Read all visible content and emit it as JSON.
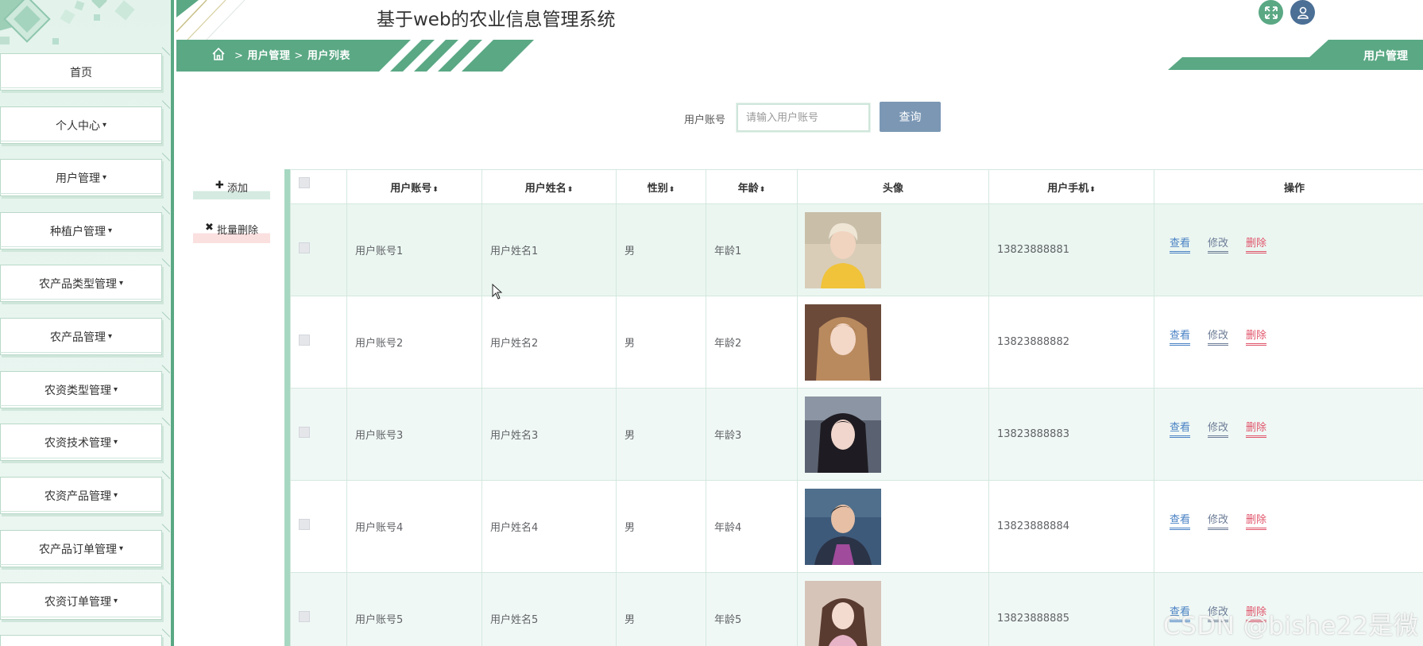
{
  "app": {
    "title": "基于web的农业信息管理系统"
  },
  "sidebar": {
    "items": [
      {
        "label": "首页",
        "has_caret": false
      },
      {
        "label": "个人中心",
        "has_caret": true
      },
      {
        "label": "用户管理",
        "has_caret": true
      },
      {
        "label": "种植户管理",
        "has_caret": true
      },
      {
        "label": "农产品类型管理",
        "has_caret": true
      },
      {
        "label": "农产品管理",
        "has_caret": true
      },
      {
        "label": "农资类型管理",
        "has_caret": true
      },
      {
        "label": "农资技术管理",
        "has_caret": true
      },
      {
        "label": "农资产品管理",
        "has_caret": true
      },
      {
        "label": "农产品订单管理",
        "has_caret": true
      },
      {
        "label": "农资订单管理",
        "has_caret": true
      }
    ],
    "caret": "▾"
  },
  "header": {
    "fullscreen_icon": "fullscreen-icon",
    "user_icon": "user-icon"
  },
  "breadcrumb": {
    "home_icon": "home-icon",
    "separator": ">",
    "items": [
      "用户管理",
      "用户列表"
    ]
  },
  "right_tab": {
    "label": "用户管理"
  },
  "search": {
    "label": "用户账号",
    "placeholder": "请输入用户账号",
    "button_label": "查询"
  },
  "actions": {
    "add_icon": "✚",
    "add_label": "添加",
    "batch_delete_icon": "✖",
    "batch_delete_label": "批量删除"
  },
  "table": {
    "columns": [
      {
        "label": "用户账号",
        "sortable": true
      },
      {
        "label": "用户姓名",
        "sortable": true
      },
      {
        "label": "性别",
        "sortable": true
      },
      {
        "label": "年龄",
        "sortable": true
      },
      {
        "label": "头像",
        "sortable": false
      },
      {
        "label": "用户手机",
        "sortable": true
      },
      {
        "label": "操作",
        "sortable": false
      }
    ],
    "sort_icon": "⬍",
    "rows": [
      {
        "account": "用户账号1",
        "name": "用户姓名1",
        "gender": "男",
        "age": "年龄1",
        "phone": "13823888881"
      },
      {
        "account": "用户账号2",
        "name": "用户姓名2",
        "gender": "男",
        "age": "年龄2",
        "phone": "13823888882"
      },
      {
        "account": "用户账号3",
        "name": "用户姓名3",
        "gender": "男",
        "age": "年龄3",
        "phone": "13823888883"
      },
      {
        "account": "用户账号4",
        "name": "用户姓名4",
        "gender": "男",
        "age": "年龄4",
        "phone": "13823888884"
      },
      {
        "account": "用户账号5",
        "name": "用户姓名5",
        "gender": "男",
        "age": "年龄5",
        "phone": "13823888885"
      }
    ],
    "ops": {
      "view": "查看",
      "edit": "修改",
      "delete": "删除"
    }
  },
  "watermark": "CSDN @bishe22是微",
  "colors": {
    "accent": "#5aa884",
    "sidebar_bg": "#e3f3ec",
    "search_button": "#7b97b4",
    "link_view": "#4a82c4",
    "link_edit": "#6c7c96",
    "link_delete": "#e0546a",
    "row_highlight": "#ebf6f1"
  }
}
